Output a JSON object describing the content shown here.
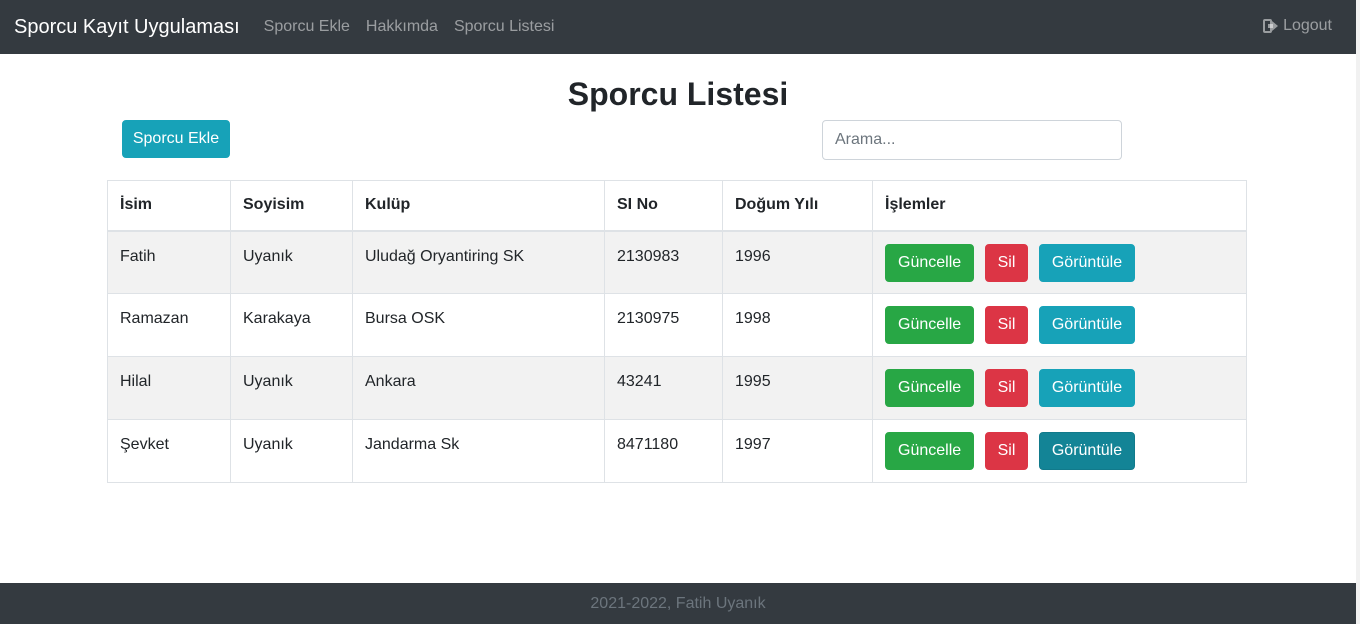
{
  "navbar": {
    "brand": "Sporcu Kayıt Uygulaması",
    "links": [
      "Sporcu Ekle",
      "Hakkımda",
      "Sporcu Listesi"
    ],
    "logout": "Logout"
  },
  "page": {
    "title": "Sporcu Listesi",
    "add_button": "Sporcu Ekle",
    "search_placeholder": "Arama..."
  },
  "table": {
    "headers": [
      "İsim",
      "Soyisim",
      "Kulüp",
      "SI No",
      "Doğum Yılı",
      "İşlemler"
    ],
    "rows": [
      [
        "Fatih",
        "Uyanık",
        "Uludağ Oryantiring SK",
        "2130983",
        "1996"
      ],
      [
        "Ramazan",
        "Karakaya",
        "Bursa OSK",
        "2130975",
        "1998"
      ],
      [
        "Hilal",
        "Uyanık",
        "Ankara",
        "43241",
        "1995"
      ],
      [
        "Şevket",
        "Uyanık",
        "Jandarma Sk",
        "8471180",
        "1997"
      ]
    ],
    "actions": {
      "update": "Güncelle",
      "delete": "Sil",
      "view": "Görüntüle"
    }
  },
  "footer": {
    "text": "2021-2022, Fatih Uyanık"
  },
  "colors": {
    "navbar": "#343a40",
    "info": "#17a2b8",
    "success": "#28a745",
    "danger": "#dc3545"
  },
  "icons": {
    "logout": "sign-out-icon"
  }
}
